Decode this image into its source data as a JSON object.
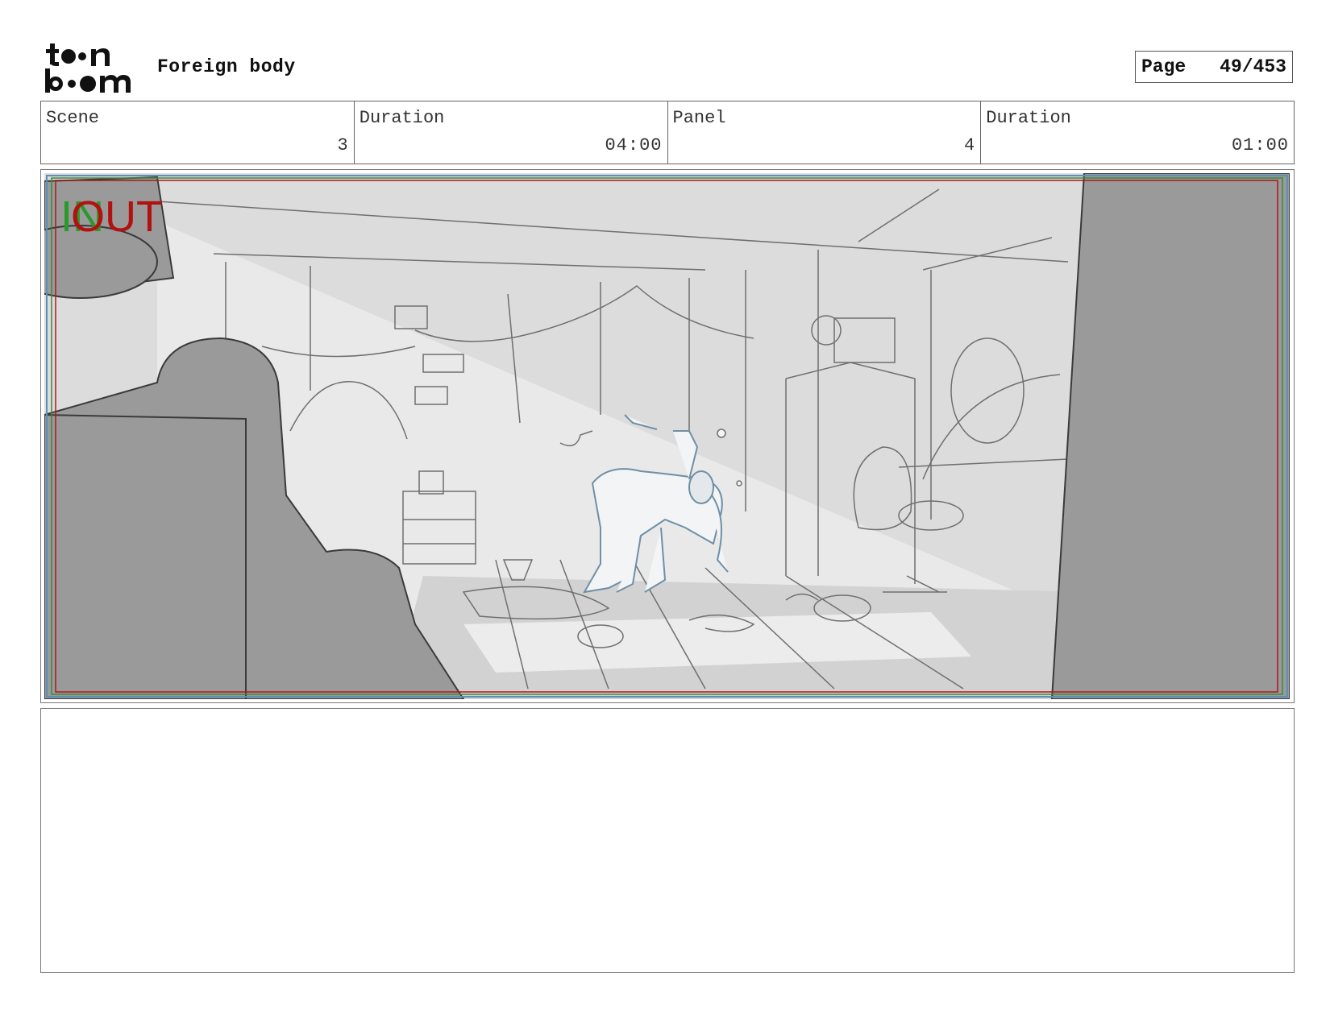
{
  "header": {
    "logo_text": "toon boom",
    "title": "Foreign body",
    "page_label": "Page",
    "page_number": "49/453"
  },
  "info": {
    "scene_label": "Scene",
    "scene_value": "3",
    "scene_duration_label": "Duration",
    "scene_duration_value": "04:00",
    "panel_label": "Panel",
    "panel_value": "4",
    "panel_duration_label": "Duration",
    "panel_duration_value": "01:00"
  },
  "panel": {
    "in_marker": "IN",
    "out_marker": "OUT"
  },
  "notes": {
    "text": ""
  }
}
